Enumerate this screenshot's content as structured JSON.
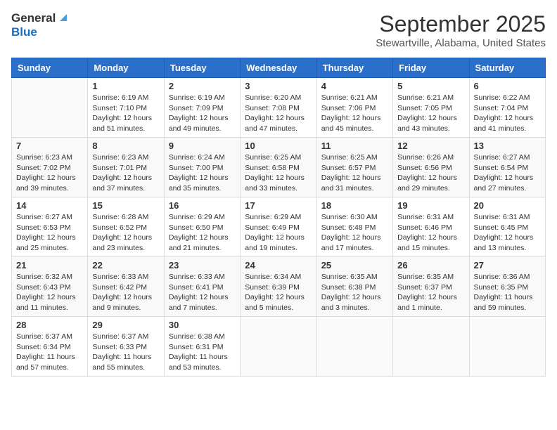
{
  "header": {
    "logo_general": "General",
    "logo_blue": "Blue",
    "month": "September 2025",
    "location": "Stewartville, Alabama, United States"
  },
  "days_of_week": [
    "Sunday",
    "Monday",
    "Tuesday",
    "Wednesday",
    "Thursday",
    "Friday",
    "Saturday"
  ],
  "weeks": [
    [
      {
        "day": "",
        "info": ""
      },
      {
        "day": "1",
        "info": "Sunrise: 6:19 AM\nSunset: 7:10 PM\nDaylight: 12 hours\nand 51 minutes."
      },
      {
        "day": "2",
        "info": "Sunrise: 6:19 AM\nSunset: 7:09 PM\nDaylight: 12 hours\nand 49 minutes."
      },
      {
        "day": "3",
        "info": "Sunrise: 6:20 AM\nSunset: 7:08 PM\nDaylight: 12 hours\nand 47 minutes."
      },
      {
        "day": "4",
        "info": "Sunrise: 6:21 AM\nSunset: 7:06 PM\nDaylight: 12 hours\nand 45 minutes."
      },
      {
        "day": "5",
        "info": "Sunrise: 6:21 AM\nSunset: 7:05 PM\nDaylight: 12 hours\nand 43 minutes."
      },
      {
        "day": "6",
        "info": "Sunrise: 6:22 AM\nSunset: 7:04 PM\nDaylight: 12 hours\nand 41 minutes."
      }
    ],
    [
      {
        "day": "7",
        "info": "Sunrise: 6:23 AM\nSunset: 7:02 PM\nDaylight: 12 hours\nand 39 minutes."
      },
      {
        "day": "8",
        "info": "Sunrise: 6:23 AM\nSunset: 7:01 PM\nDaylight: 12 hours\nand 37 minutes."
      },
      {
        "day": "9",
        "info": "Sunrise: 6:24 AM\nSunset: 7:00 PM\nDaylight: 12 hours\nand 35 minutes."
      },
      {
        "day": "10",
        "info": "Sunrise: 6:25 AM\nSunset: 6:58 PM\nDaylight: 12 hours\nand 33 minutes."
      },
      {
        "day": "11",
        "info": "Sunrise: 6:25 AM\nSunset: 6:57 PM\nDaylight: 12 hours\nand 31 minutes."
      },
      {
        "day": "12",
        "info": "Sunrise: 6:26 AM\nSunset: 6:56 PM\nDaylight: 12 hours\nand 29 minutes."
      },
      {
        "day": "13",
        "info": "Sunrise: 6:27 AM\nSunset: 6:54 PM\nDaylight: 12 hours\nand 27 minutes."
      }
    ],
    [
      {
        "day": "14",
        "info": "Sunrise: 6:27 AM\nSunset: 6:53 PM\nDaylight: 12 hours\nand 25 minutes."
      },
      {
        "day": "15",
        "info": "Sunrise: 6:28 AM\nSunset: 6:52 PM\nDaylight: 12 hours\nand 23 minutes."
      },
      {
        "day": "16",
        "info": "Sunrise: 6:29 AM\nSunset: 6:50 PM\nDaylight: 12 hours\nand 21 minutes."
      },
      {
        "day": "17",
        "info": "Sunrise: 6:29 AM\nSunset: 6:49 PM\nDaylight: 12 hours\nand 19 minutes."
      },
      {
        "day": "18",
        "info": "Sunrise: 6:30 AM\nSunset: 6:48 PM\nDaylight: 12 hours\nand 17 minutes."
      },
      {
        "day": "19",
        "info": "Sunrise: 6:31 AM\nSunset: 6:46 PM\nDaylight: 12 hours\nand 15 minutes."
      },
      {
        "day": "20",
        "info": "Sunrise: 6:31 AM\nSunset: 6:45 PM\nDaylight: 12 hours\nand 13 minutes."
      }
    ],
    [
      {
        "day": "21",
        "info": "Sunrise: 6:32 AM\nSunset: 6:43 PM\nDaylight: 12 hours\nand 11 minutes."
      },
      {
        "day": "22",
        "info": "Sunrise: 6:33 AM\nSunset: 6:42 PM\nDaylight: 12 hours\nand 9 minutes."
      },
      {
        "day": "23",
        "info": "Sunrise: 6:33 AM\nSunset: 6:41 PM\nDaylight: 12 hours\nand 7 minutes."
      },
      {
        "day": "24",
        "info": "Sunrise: 6:34 AM\nSunset: 6:39 PM\nDaylight: 12 hours\nand 5 minutes."
      },
      {
        "day": "25",
        "info": "Sunrise: 6:35 AM\nSunset: 6:38 PM\nDaylight: 12 hours\nand 3 minutes."
      },
      {
        "day": "26",
        "info": "Sunrise: 6:35 AM\nSunset: 6:37 PM\nDaylight: 12 hours\nand 1 minute."
      },
      {
        "day": "27",
        "info": "Sunrise: 6:36 AM\nSunset: 6:35 PM\nDaylight: 11 hours\nand 59 minutes."
      }
    ],
    [
      {
        "day": "28",
        "info": "Sunrise: 6:37 AM\nSunset: 6:34 PM\nDaylight: 11 hours\nand 57 minutes."
      },
      {
        "day": "29",
        "info": "Sunrise: 6:37 AM\nSunset: 6:33 PM\nDaylight: 11 hours\nand 55 minutes."
      },
      {
        "day": "30",
        "info": "Sunrise: 6:38 AM\nSunset: 6:31 PM\nDaylight: 11 hours\nand 53 minutes."
      },
      {
        "day": "",
        "info": ""
      },
      {
        "day": "",
        "info": ""
      },
      {
        "day": "",
        "info": ""
      },
      {
        "day": "",
        "info": ""
      }
    ]
  ]
}
